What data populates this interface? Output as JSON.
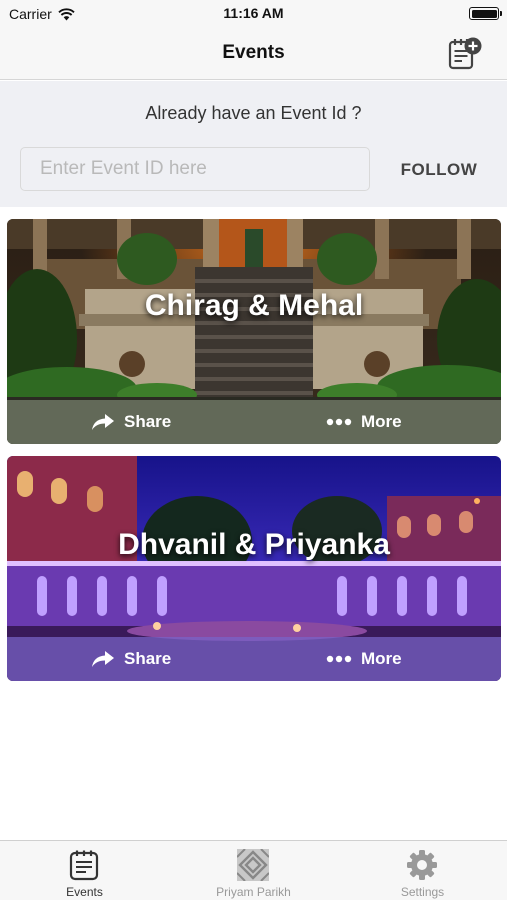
{
  "status_bar": {
    "carrier": "Carrier",
    "time": "11:16 AM"
  },
  "nav": {
    "title": "Events",
    "add_icon": "add-event-icon"
  },
  "follow": {
    "prompt": "Already have an Event Id ?",
    "input_placeholder": "Enter Event ID here",
    "input_value": "",
    "button_label": "FOLLOW"
  },
  "events": [
    {
      "name": "Chirag & Mehal",
      "share_label": "Share",
      "more_label": "More",
      "image": "palace-staircase-garden-night-photo"
    },
    {
      "name": "Dhvanil & Priyanka",
      "share_label": "Share",
      "more_label": "More",
      "image": "palace-courtyard-lit-purple-evening-photo"
    }
  ],
  "tab_bar": {
    "tabs": [
      {
        "label": "Events",
        "icon": "events-list-icon",
        "active": true
      },
      {
        "label": "Priyam Parikh",
        "icon": "studio-logo-icon",
        "active": false
      },
      {
        "label": "Settings",
        "icon": "gear-icon",
        "active": false
      }
    ]
  },
  "colors": {
    "bar_background": "#f7f7f7",
    "follow_section_background": "#eff0f4",
    "active_tab": "#333333",
    "inactive_tab": "#999999"
  }
}
